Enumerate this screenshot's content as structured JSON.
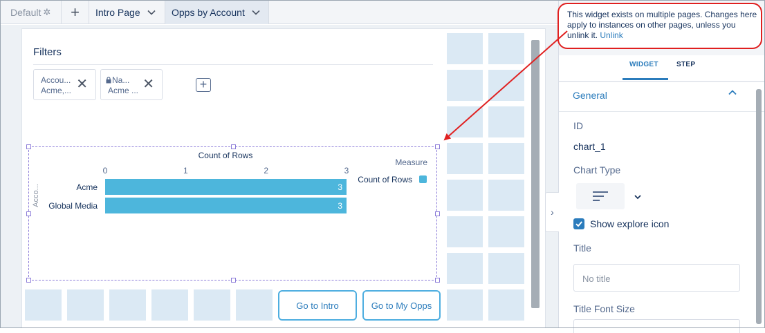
{
  "tabs": {
    "default_label": "Default",
    "add_label": "+",
    "page_tabs": [
      {
        "label": "Intro Page"
      },
      {
        "label": "Opps by Account"
      }
    ]
  },
  "filters": {
    "title": "Filters",
    "pills": [
      {
        "line1": "Accou...",
        "line2": "Acme,..."
      },
      {
        "line1": "Na...",
        "line2": "Acme ..."
      }
    ],
    "remove_glyph": "✕",
    "add_glyph": "+"
  },
  "chart_data": {
    "type": "bar",
    "orientation": "horizontal",
    "title": "Count of Rows",
    "xlabel": "Count of Rows",
    "ylabel": "Acco...",
    "categories": [
      "Acme",
      "Global Media"
    ],
    "values": [
      3,
      3
    ],
    "value_labels": [
      "3",
      "3"
    ],
    "xlim": [
      0,
      3
    ],
    "x_ticks": [
      "0",
      "1",
      "2",
      "3"
    ],
    "legend": {
      "title": "Measure",
      "entries": [
        "Count of Rows"
      ],
      "placement": "right"
    },
    "color": "#4db6dc",
    "grid": false
  },
  "buttons": {
    "go_to_intro": "Go to Intro",
    "go_to_my_opps": "Go to My Opps"
  },
  "panel": {
    "tabs": {
      "widget": "WIDGET",
      "step": "STEP"
    },
    "section": "General",
    "id_label": "ID",
    "id_value": "chart_1",
    "chart_type_label": "Chart Type",
    "show_explore_label": "Show explore icon",
    "show_explore_checked": true,
    "title_label": "Title",
    "title_placeholder": "No title",
    "title_font_size_label": "Title Font Size",
    "collapse_glyph": "›"
  },
  "callout": {
    "text": "This widget exists on multiple pages. Changes here apply to instances on other pages, unless you unlink it.",
    "link": "Unlink"
  },
  "colors": {
    "accent": "#2b7cbc",
    "bar": "#4db6dc",
    "callout_border": "#e02020",
    "selection": "#8b7bd8",
    "placeholder_cell": "#dbe9f4"
  },
  "icons": {
    "default_tab": "gear-icon",
    "dropdown": "chevron-down-icon",
    "filter_lock": "lock-icon",
    "chart_type": "horizontal-bar-chart-icon",
    "section_toggle": "chevron-up-icon",
    "panel_toggle": "chevron-right-icon"
  }
}
